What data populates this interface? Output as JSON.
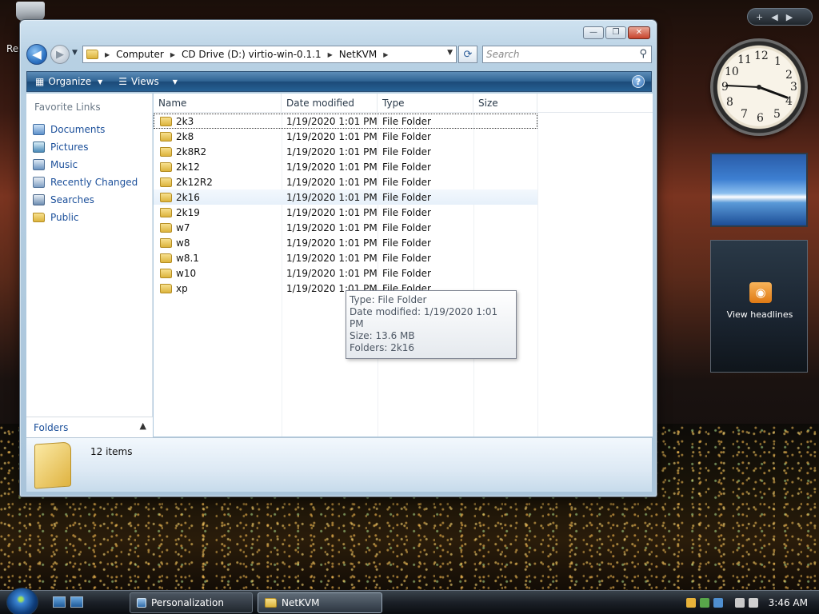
{
  "desktop": {
    "recycle_label": "Re"
  },
  "window": {
    "caption": {
      "minimize": "—",
      "maximize": "❐",
      "close": "✕"
    },
    "nav": {
      "back": "◀",
      "forward": "▶"
    },
    "address": {
      "segments": [
        "Computer",
        "CD Drive (D:) virtio-win-0.1.1",
        "NetKVM"
      ]
    },
    "search": {
      "placeholder": "Search"
    },
    "toolbar": {
      "organize": "Organize",
      "views": "Views",
      "help": "?"
    },
    "favorites": {
      "title": "Favorite Links",
      "items": [
        {
          "label": "Documents",
          "icon": "documents-icon"
        },
        {
          "label": "Pictures",
          "icon": "pictures-icon"
        },
        {
          "label": "Music",
          "icon": "music-icon"
        },
        {
          "label": "Recently Changed",
          "icon": "recent-icon"
        },
        {
          "label": "Searches",
          "icon": "searches-icon"
        },
        {
          "label": "Public",
          "icon": "public-folder-icon"
        }
      ]
    },
    "folders_label": "Folders",
    "columns": {
      "name": "Name",
      "date": "Date modified",
      "type": "Type",
      "size": "Size"
    },
    "rows": [
      {
        "name": "2k3",
        "date": "1/19/2020 1:01 PM",
        "type": "File Folder"
      },
      {
        "name": "2k8",
        "date": "1/19/2020 1:01 PM",
        "type": "File Folder"
      },
      {
        "name": "2k8R2",
        "date": "1/19/2020 1:01 PM",
        "type": "File Folder"
      },
      {
        "name": "2k12",
        "date": "1/19/2020 1:01 PM",
        "type": "File Folder"
      },
      {
        "name": "2k12R2",
        "date": "1/19/2020 1:01 PM",
        "type": "File Folder"
      },
      {
        "name": "2k16",
        "date": "1/19/2020 1:01 PM",
        "type": "File Folder"
      },
      {
        "name": "2k19",
        "date": "1/19/2020 1:01 PM",
        "type": "File Folder"
      },
      {
        "name": "w7",
        "date": "1/19/2020 1:01 PM",
        "type": "File Folder"
      },
      {
        "name": "w8",
        "date": "1/19/2020 1:01 PM",
        "type": "File Folder"
      },
      {
        "name": "w8.1",
        "date": "1/19/2020 1:01 PM",
        "type": "File Folder"
      },
      {
        "name": "w10",
        "date": "1/19/2020 1:01 PM",
        "type": "File Folder"
      },
      {
        "name": "xp",
        "date": "1/19/2020 1:01 PM",
        "type": "File Folder"
      }
    ],
    "tooltip": {
      "type": "Type: File Folder",
      "date": "Date modified: 1/19/2020 1:01 PM",
      "size": "Size: 13.6 MB",
      "folders": "Folders: 2k16"
    },
    "details": {
      "count": "12 items"
    }
  },
  "gadgets": {
    "controls": {
      "add": "+",
      "prev": "◀",
      "next": "▶"
    },
    "clock": {
      "numbers": [
        "12",
        "1",
        "2",
        "3",
        "4",
        "5",
        "6",
        "7",
        "8",
        "9",
        "10",
        "11"
      ]
    },
    "feed": {
      "label": "View headlines"
    }
  },
  "taskbar": {
    "buttons": [
      {
        "label": "Personalization"
      },
      {
        "label": "NetKVM"
      }
    ],
    "time": "3:46 AM"
  }
}
